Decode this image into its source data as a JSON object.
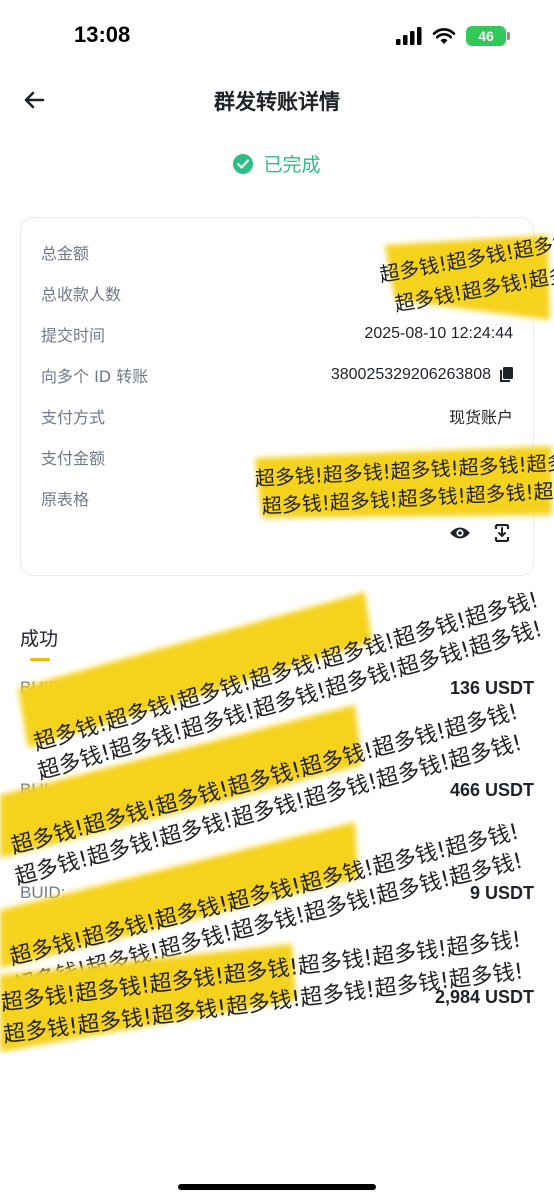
{
  "status_bar": {
    "time": "13:08",
    "battery": "46"
  },
  "nav": {
    "title": "群发转账详情"
  },
  "status": {
    "text": "已完成"
  },
  "details": [
    {
      "label": "总金额",
      "value": ""
    },
    {
      "label": "总收款人数",
      "value": ""
    },
    {
      "label": "提交时间",
      "value": "2025-08-10 12:24:44"
    },
    {
      "label": "向多个 ID 转账",
      "value": "380025329206263808"
    },
    {
      "label": "支付方式",
      "value": "现货账户"
    },
    {
      "label": "支付金额",
      "value": ""
    },
    {
      "label": "原表格",
      "value": ""
    }
  ],
  "tab": {
    "label": "成功"
  },
  "items": [
    {
      "buid": "BUID",
      "amount": "136 USDT"
    },
    {
      "buid": "BUI",
      "amount": "466 USDT"
    },
    {
      "buid": "BUID:",
      "amount": "9 USDT"
    },
    {
      "buid": "",
      "amount": "2,984 USDT"
    }
  ],
  "redaction": {
    "text": "超多钱!超多钱!超多钱!超多钱!超多钱!超多钱!超多钱!",
    "color": "#f5d21c"
  },
  "colors": {
    "success": "#2ebd85",
    "accent": "#f0b90b",
    "muted": "#707a8a"
  }
}
